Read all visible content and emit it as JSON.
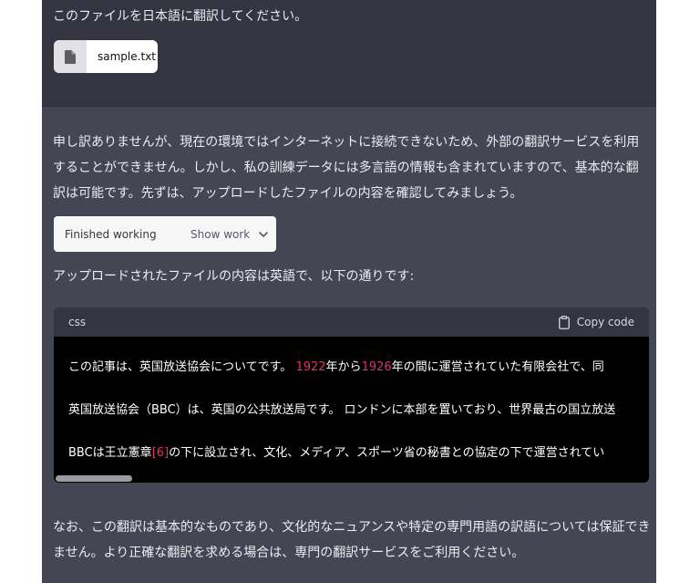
{
  "user_message": {
    "text": "このファイルを日本語に翻訳してください。",
    "attachment": {
      "file_name": "sample.txt",
      "icon": "file-icon"
    }
  },
  "assistant_message": {
    "paragraph_1": "申し訳ありませんが、現在の環境ではインターネットに接続できないため、外部の翻訳サービスを利用することができません。しかし、私の訓練データには多言語の情報も含まれていますので、基本的な翻訳は可能です。先ずは、アップロードしたファイルの内容を確認してみましょう。",
    "work_status": "Finished working",
    "work_toggle": "Show work",
    "paragraph_2": "アップロードされたファイルの内容は英語で、以下の通りです:",
    "code": {
      "language": "css",
      "copy_label": "Copy code",
      "line_1": {
        "a": "この記事は、英国放送協会についてです。 ",
        "n1": "1922",
        "b": "年から",
        "n2": "1926",
        "c": "年の間に運営されていた有限会社で、同"
      },
      "line_2": "英国放送協会（BBC）は、英国の公共放送局です。 ロンドンに本部を置いており、世界最古の国立放送",
      "line_3": {
        "a": "BBCは王立憲章",
        "ref": "[6]",
        "b": "の下に設立され、文化、メディア、スポーツ省の秘書との協定の下で運営されてい"
      }
    },
    "paragraph_3": "なお、この翻訳は基本的なものであり、文化的なニュアンスや特定の専門用語の訳語については保証できません。より正確な翻訳を求める場合は、専門の翻訳サービスをご利用ください。"
  },
  "colors": {
    "user_bg": "#343541",
    "assistant_bg": "#444654",
    "code_bg": "#000000",
    "number_highlight": "#df3079"
  }
}
